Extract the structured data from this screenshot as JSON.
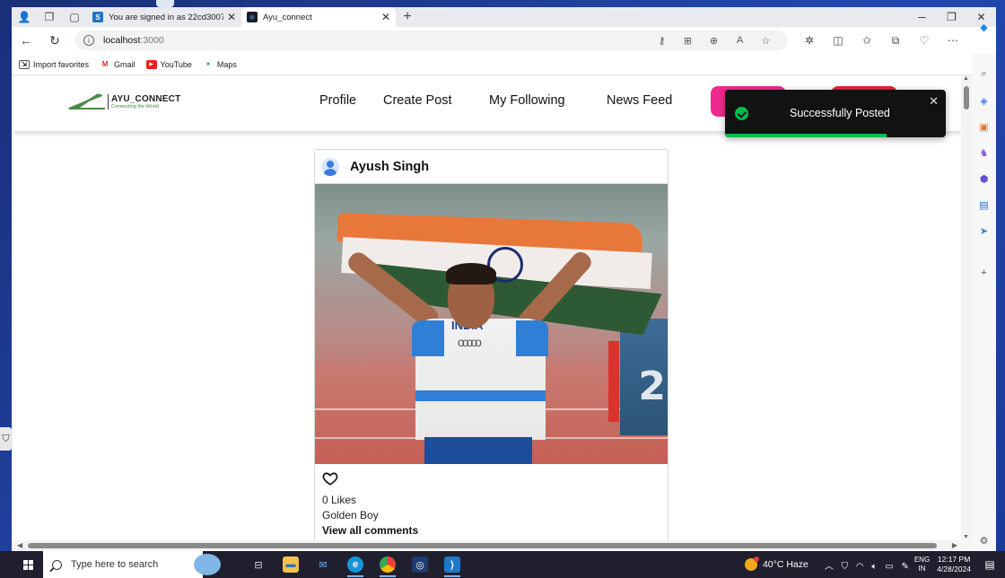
{
  "browser": {
    "tabs": [
      {
        "title": "You are signed in as 22cd3007",
        "favicon": "S",
        "favicon_color": "#1f74c8",
        "active": false
      },
      {
        "title": "Ayu_connect",
        "favicon": "⚛",
        "favicon_color": "#1b1b2a",
        "active": true
      }
    ],
    "url_host": "localhost",
    "url_port": ":3000",
    "bookmarks": [
      {
        "label": "Import favorites",
        "icon": "import-icon"
      },
      {
        "label": "Gmail",
        "icon": "gmail-icon"
      },
      {
        "label": "YouTube",
        "icon": "youtube-icon"
      },
      {
        "label": "Maps",
        "icon": "maps-icon"
      }
    ]
  },
  "site": {
    "logo_title": "AYU_CONNECT",
    "logo_tagline": "Connecting the World",
    "nav": [
      {
        "label": "Profile"
      },
      {
        "label": "Create Post"
      },
      {
        "label": "My Following"
      },
      {
        "label": "News Feed"
      }
    ],
    "accent_pink": "#f02a8f",
    "accent_red": "#e0243a"
  },
  "post": {
    "author": "Ayush Singh",
    "likes": "0 Likes",
    "caption": "Golden Boy",
    "view_comments": "View all comments",
    "photo_jersey_text": "INDIA",
    "photo_sign_text": "2"
  },
  "toast": {
    "message": "Successfully Posted",
    "type": "success",
    "progress": 0.73,
    "color": "#07bc4c"
  },
  "taskbar": {
    "search_placeholder": "Type here to search",
    "weather_temp": "40°C",
    "weather_desc": "Haze",
    "lang_top": "ENG",
    "lang_bottom": "IN",
    "time": "12:17 PM",
    "date": "4/28/2024"
  }
}
